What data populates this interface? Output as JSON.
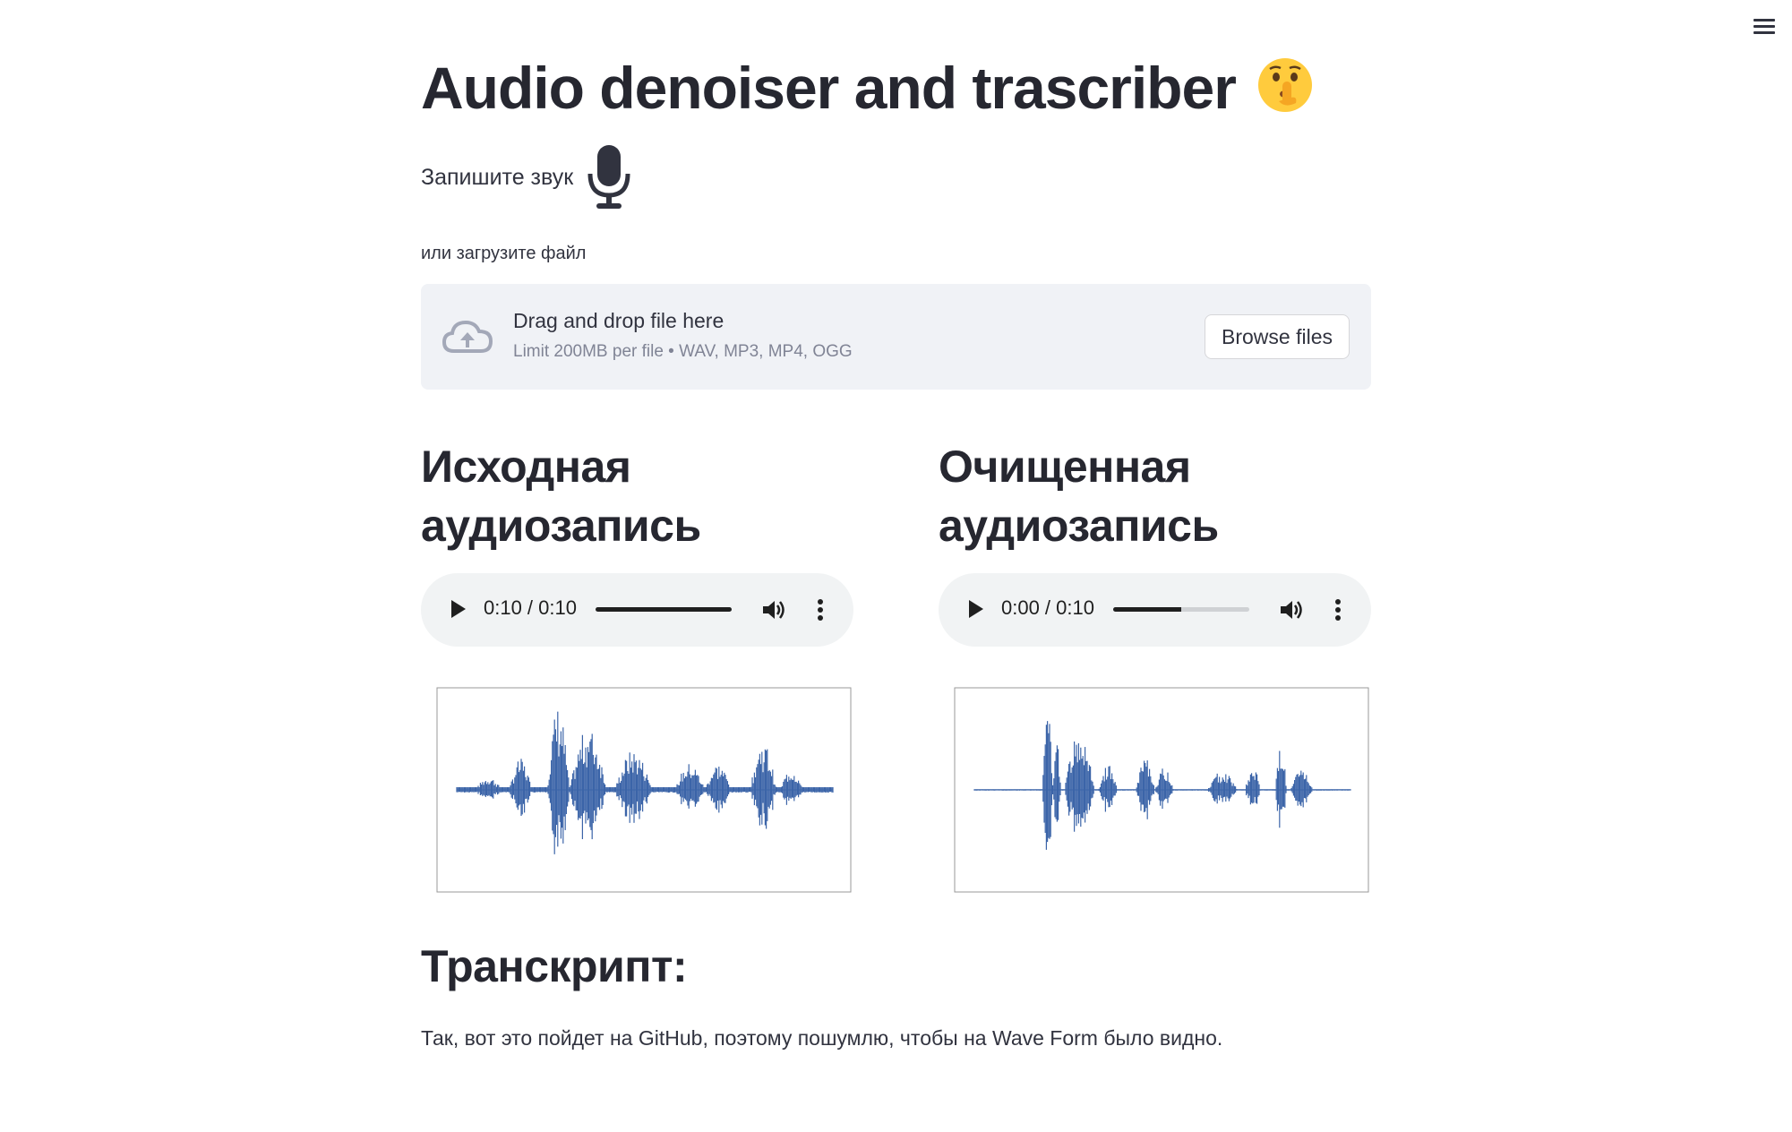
{
  "app": {
    "title": "Audio denoiser and trascriber",
    "title_emoji": "shushing-face-emoji"
  },
  "record": {
    "label": "Запишите звук",
    "icon": "microphone-icon"
  },
  "upload": {
    "caption": "или загрузите файл",
    "drop_title": "Drag and drop file here",
    "limits": "Limit 200MB per file • WAV, MP3, MP4, OGG",
    "browse_label": "Browse files",
    "icon": "cloud-upload-icon"
  },
  "original": {
    "heading_line1": "Исходная",
    "heading_line2": "аудиозапись",
    "player": {
      "time": "0:10 / 0:10",
      "progress": 1.0
    }
  },
  "cleaned": {
    "heading_line1": "Очищенная",
    "heading_line2": "аудиозапись",
    "player": {
      "time": "0:00 / 0:10",
      "progress": 0.5
    }
  },
  "transcript": {
    "heading": "Транскрипт:",
    "text": "Так, вот это пойдет на GitHub, поэтому пошумлю, чтобы на Wave Form было видно."
  },
  "colors": {
    "accent_text": "#31333F",
    "heading": "#262730",
    "dropzone_bg": "#F0F2F6",
    "player_bg": "#F1F3F4",
    "waveform": "#3B64A8",
    "muted": "#808495"
  }
}
